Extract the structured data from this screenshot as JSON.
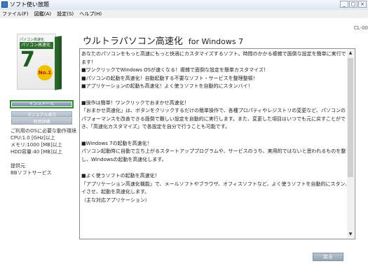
{
  "window": {
    "title": "ソフト使い放題",
    "buttons": [
      "_",
      "□",
      "×"
    ]
  },
  "menubar": [
    "ファイル(F)",
    "図鑑(A)",
    "設定(S)",
    "ヘルプ(H)"
  ],
  "version": "CL-00",
  "product": {
    "box_top_text": "パソコン高速化",
    "box_title": "パソコン高速化",
    "box_number": "7",
    "badge": "No.1",
    "heading": "ウルトラパソコン高速化",
    "os": "for Windows 7"
  },
  "left": {
    "install_label": "インストール",
    "disabled_label": "マニュアル表示",
    "terms_label": "利用詳細",
    "requirements": [
      "ご利用のOSに必要な動作環境",
      "CPU:1.0 [GHz]以上",
      "メモリ:1000 [MB]以上",
      "HDD容量:40 [MB]以上"
    ],
    "provider_label": "提供元",
    "provider_name": "BBソフトサービス"
  },
  "description": [
    "あなたのパソコンをもっと高速にもっと快適にカスタマイズするソフト。時間のかかる複雑で面倒な設定を簡単に実行でき",
    "ます！",
    "■ワンクリックでWindows OSが速くなる！複雑で面倒な設定を簡単カスタマイズ！",
    "■パソコンの起動を高速化！自動起動する不要なソフト・サービスを整理整頓！",
    "■アプリケーションの起動も高速化！よく使うソフトを自動的にスタンバイ！",
    "",
    "■操作は簡単！ワンクリックでおまかせ高速化！",
    "「おまかせ高速化」は、ボタンをクリックするだけの簡単操作で、各種プロパティやレジストリの変更など、パソコンの",
    "パフォーマンスを改善できる面倒で難しい設定を自動的に実行します。また、変更した項目はいつでも元に戻すことがで",
    "き、「高速化カスタマイズ」で各設定を自分で行うことも可能です。",
    "",
    "■Windows 7の起動を高速化！",
    "パソコン起動時に自動で立ち上がるスタートアッププログラムや、サービスのうち、実用的ではないと思われるものを整理",
    "し、Windowsの起動を高速化します。",
    "",
    "■よく使うソフトの起動を高速化！",
    "「アプリケーション高速化機能」で、メールソフトやブラウザ、オフィスソフトなど、よく使うソフトを自動的にスタンバ",
    "イさせ、起動を高速化します。",
    "（主な対応アプリケーション）"
  ],
  "back_label": "戻る"
}
